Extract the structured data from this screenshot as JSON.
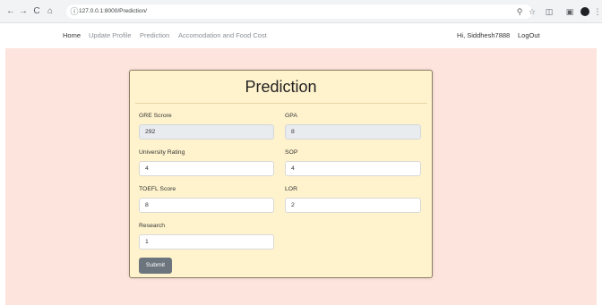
{
  "browser": {
    "url": "127.0.0.1:8000/Prediction/",
    "back_icon": "←",
    "forward_icon": "→",
    "reload_icon": "C",
    "home_icon": "⌂",
    "info_icon": "ⓘ",
    "zoom_icon": "⚲",
    "star_icon": "☆",
    "extension_icon": "◫",
    "sidebar_icon": "▣",
    "menu_icon": "⋮"
  },
  "navbar": {
    "links": [
      "Home",
      "Update Profile",
      "Prediction",
      "Accomodation and Food Cost"
    ],
    "greeting": "Hi, Siddhesh7888",
    "logout": "LogOut"
  },
  "form": {
    "title": "Prediction",
    "fields": [
      {
        "label": "GRE Scrore",
        "value": "292",
        "readonly": true
      },
      {
        "label": "GPA",
        "value": "8",
        "readonly": true
      },
      {
        "label": "University Rating",
        "value": "4",
        "readonly": false
      },
      {
        "label": "SOP",
        "value": "4",
        "readonly": false
      },
      {
        "label": "TOEFL Score",
        "value": "8",
        "readonly": false
      },
      {
        "label": "LOR",
        "value": "2",
        "readonly": false
      },
      {
        "label": "Research",
        "value": "1",
        "readonly": false
      }
    ],
    "submit_label": "Submit"
  },
  "colors": {
    "page_background": "#fde4dc",
    "card_background": "#fff3cd",
    "submit_button": "#6c757d",
    "readonly_input": "#e9ecef"
  }
}
